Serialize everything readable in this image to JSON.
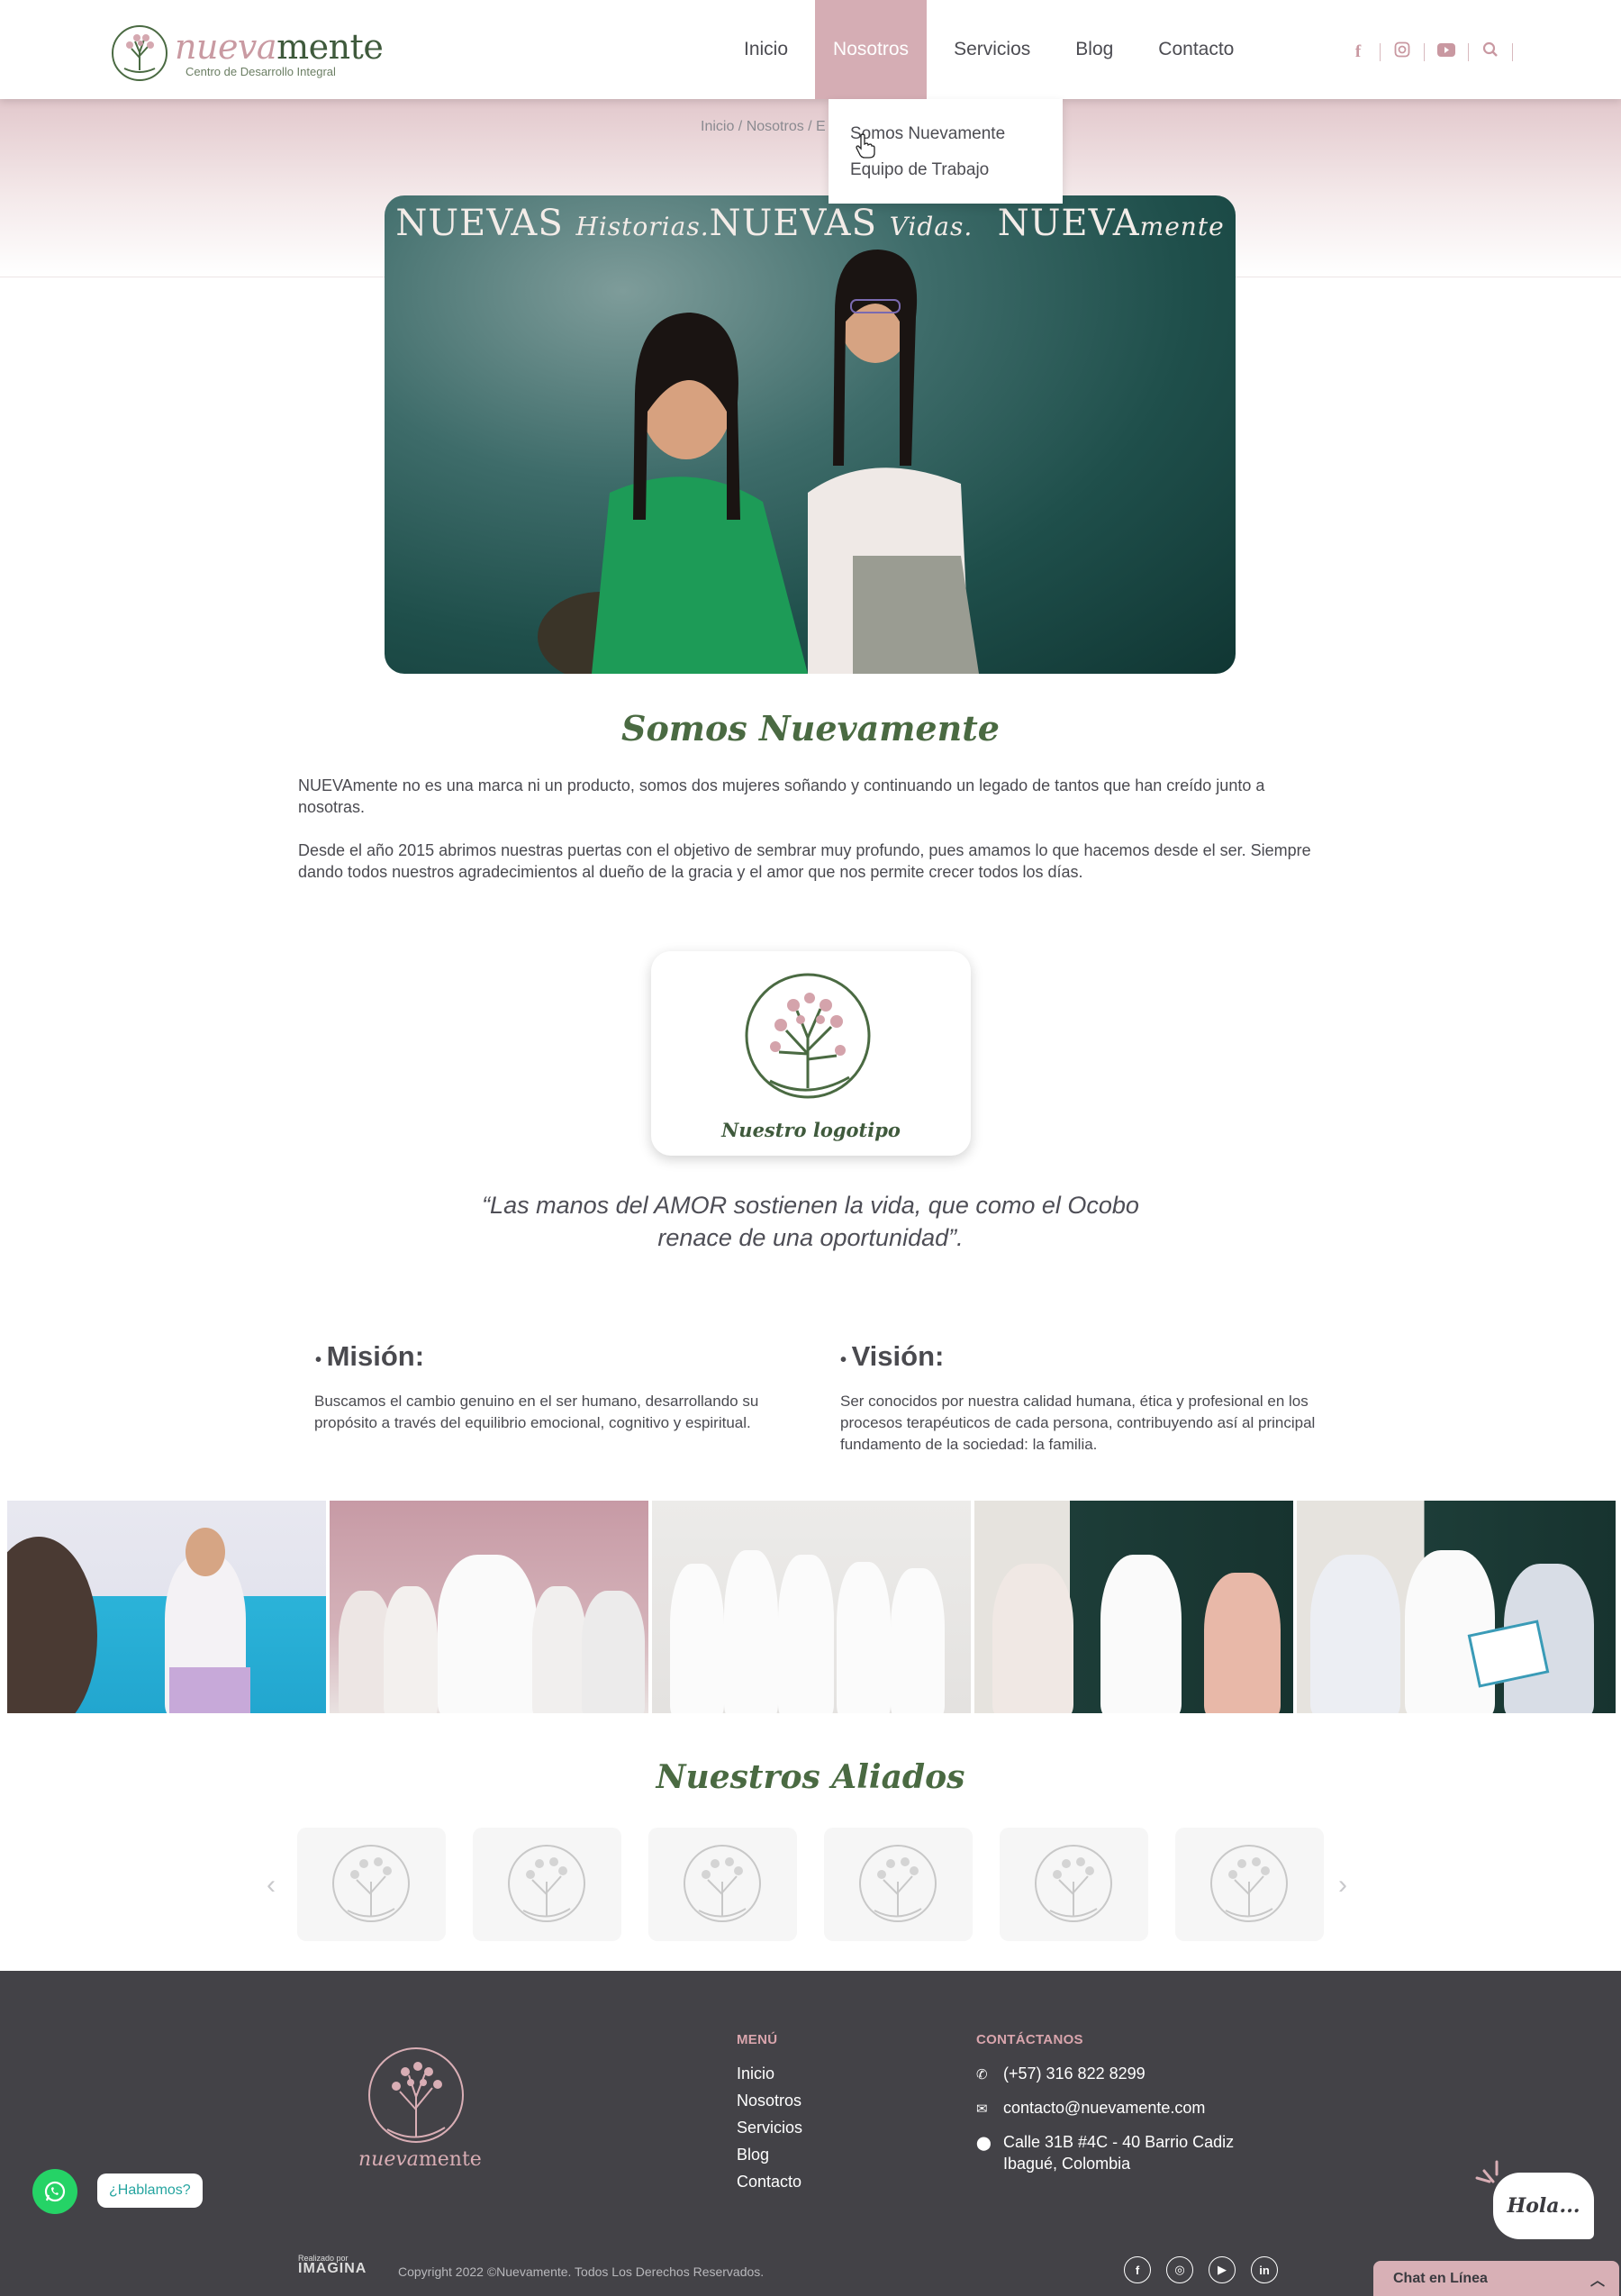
{
  "header": {
    "logo": {
      "word_a": "nueva",
      "word_b": "mente",
      "tagline": "Centro de Desarrollo Integral"
    },
    "nav": [
      {
        "label": "Inicio",
        "active": false
      },
      {
        "label": "Nosotros",
        "active": true
      },
      {
        "label": "Servicios",
        "active": false
      },
      {
        "label": "Blog",
        "active": false
      },
      {
        "label": "Contacto",
        "active": false
      }
    ],
    "socials": [
      "facebook-icon",
      "instagram-icon",
      "youtube-icon",
      "search-icon"
    ]
  },
  "dropdown": {
    "items": [
      "Somos Nuevamente",
      "Equipo de Trabajo"
    ]
  },
  "breadcrumb": "Inicio / Nosotros / E",
  "hero": {
    "word1": "NUEVAS",
    "script1": "Historias.",
    "word2": "NUEVAS",
    "script2": "Vidas.",
    "word3": "NUEVA",
    "script3": "mente"
  },
  "about": {
    "title": "Somos Nuevamente",
    "p1": "NUEVAmente no es una marca ni un producto, somos dos mujeres soñando y continuando un legado de tantos que han creído junto a nosotras.",
    "p2": "Desde el año 2015 abrimos nuestras puertas con el objetivo de sembrar muy profundo, pues amamos lo que hacemos desde el ser. Siempre dando todos nuestros agradecimientos al dueño de la gracia y el amor que nos permite crecer todos los días."
  },
  "logo_card": {
    "caption": "Nuestro logotipo"
  },
  "quote": "“Las manos del AMOR sostienen la vida, que como el Ocobo renace de una oportunidad”.",
  "mision": {
    "title": "Misión:",
    "text": "Buscamos el cambio genuino en el ser humano, desarrollando su propósito a través del equilibrio emocional, cognitivo y espiritual."
  },
  "vision": {
    "title": "Visión:",
    "text": "Ser conocidos por nuestra calidad humana, ética y profesional en los procesos terapéuticos de cada persona, contribuyendo así al principal fundamento de la sociedad: la familia."
  },
  "allies": {
    "title": "Nuestros Aliados"
  },
  "footer": {
    "menu_head": "MENÚ",
    "menu": [
      "Inicio",
      "Nosotros",
      "Servicios",
      "Blog",
      "Contacto"
    ],
    "contact_head": "CONTÁCTANOS",
    "phone": "(+57) 316 822 8299",
    "email": "contacto@nuevamente.com",
    "address1": "Calle 31B #4C - 40 Barrio Cadiz",
    "address2": "Ibagué, Colombia",
    "made_by_label": "Realizado por",
    "made_by_brand": "IMAGINA",
    "copyright": "Copyright 2022 ©Nuevamente. Todos Los Derechos Reservados.",
    "logo_a": "nueva",
    "logo_b": "mente"
  },
  "whatsapp": {
    "label": "¿Hablamos?"
  },
  "hola": "Hola...",
  "chat": {
    "label": "Chat en Línea"
  },
  "colors": {
    "accent": "#d5adb4",
    "green": "#4a6a42",
    "footer": "#434247"
  }
}
